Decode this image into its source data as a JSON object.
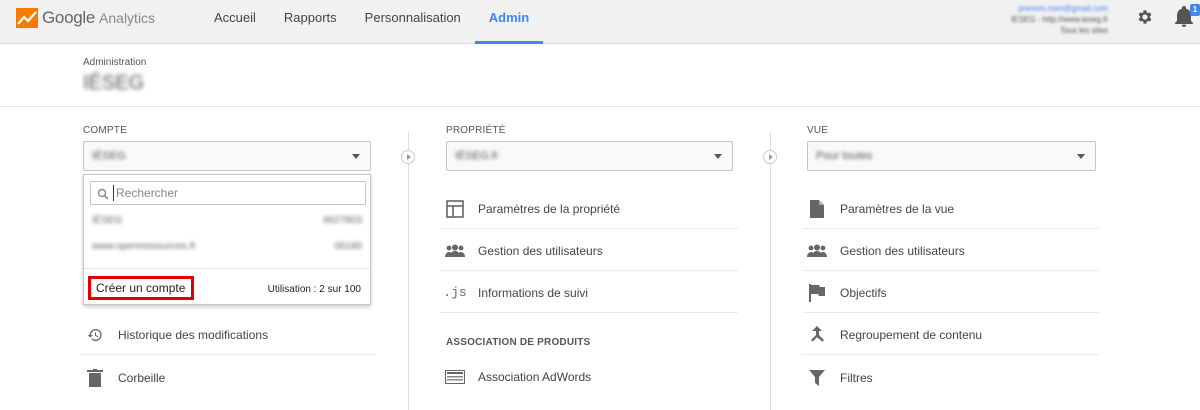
{
  "brand": {
    "google": "Google",
    "analytics": "Analytics"
  },
  "nav": [
    {
      "label": "Accueil"
    },
    {
      "label": "Rapports"
    },
    {
      "label": "Personnalisation"
    },
    {
      "label": "Admin",
      "active": true
    }
  ],
  "account_box": {
    "email": "prenom.nom@gmail.com",
    "line1": "IESEG  -  http://www.ieseg.fr",
    "line2": "Tous les sites"
  },
  "notifications": {
    "badge": "1"
  },
  "header": {
    "breadcrumb": "Administration",
    "title": "IÉSEG"
  },
  "compte": {
    "label": "COMPTE",
    "selected": "IÉSEG",
    "search_placeholder": "Rechercher",
    "accounts": [
      {
        "name": "IÉSEG",
        "id": "6627803"
      },
      {
        "name": "www.openressources.fr",
        "id": "06180"
      }
    ],
    "create_label": "Créer un compte",
    "usage": "Utilisation : 2 sur 100",
    "menu": [
      {
        "label": "Historique des modifications",
        "icon": "history-icon"
      },
      {
        "label": "Corbeille",
        "icon": "trash-icon"
      }
    ]
  },
  "propriete": {
    "label": "PROPRIÉTÉ",
    "selected": "IÉSEG.fr",
    "menu": [
      {
        "label": "Paramètres de la propriété",
        "icon": "property-settings-icon"
      },
      {
        "label": "Gestion des utilisateurs",
        "icon": "users-icon"
      },
      {
        "label": "Informations de suivi",
        "icon": "js-icon",
        "glyph": ".js"
      }
    ],
    "section": "ASSOCIATION DE PRODUITS",
    "section_menu": [
      {
        "label": "Association AdWords",
        "icon": "adwords-icon"
      }
    ]
  },
  "vue": {
    "label": "VUE",
    "selected": "Pour toutes",
    "menu": [
      {
        "label": "Paramètres de la vue",
        "icon": "document-icon"
      },
      {
        "label": "Gestion des utilisateurs",
        "icon": "users-icon"
      },
      {
        "label": "Objectifs",
        "icon": "flag-icon"
      },
      {
        "label": "Regroupement de contenu",
        "icon": "grouping-icon"
      },
      {
        "label": "Filtres",
        "icon": "filter-icon"
      }
    ]
  },
  "colors": {
    "accent": "#4285f4",
    "highlight": "#e00000"
  }
}
